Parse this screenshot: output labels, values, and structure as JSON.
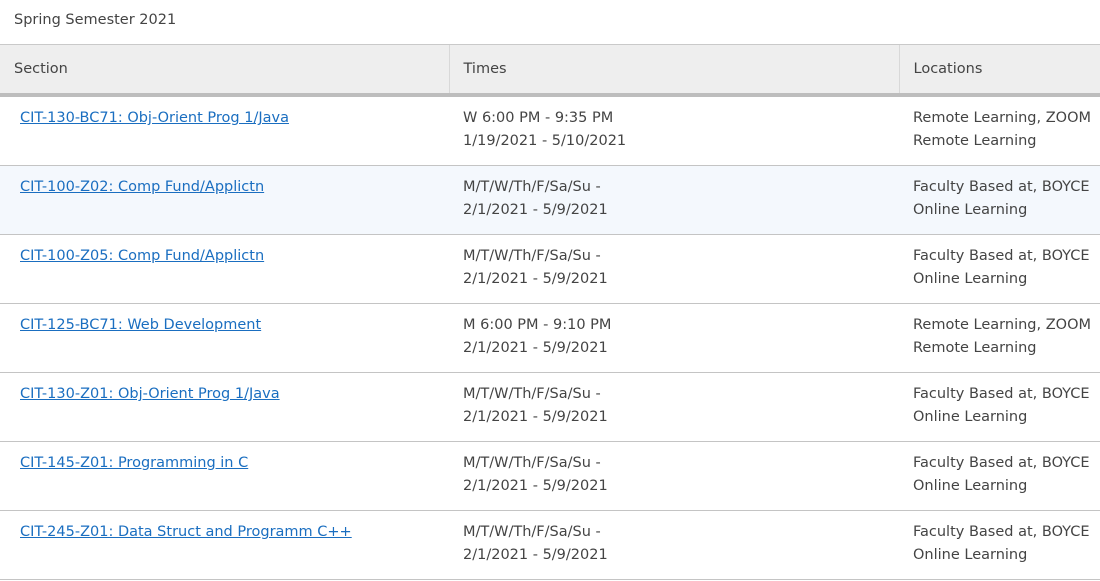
{
  "term": {
    "title": "Spring Semester 2021"
  },
  "table": {
    "headers": {
      "section": "Section",
      "times": "Times",
      "locations": "Locations"
    },
    "rows": [
      {
        "section": "CIT-130-BC71: Obj-Orient Prog 1/Java",
        "time_line1": "W 6:00 PM - 9:35 PM",
        "time_line2": "1/19/2021 - 5/10/2021",
        "location_line1": "Remote Learning, ZOOM",
        "location_line2": "Remote Learning",
        "highlighted": false
      },
      {
        "section": "CIT-100-Z02: Comp Fund/Applictn",
        "time_line1": "M/T/W/Th/F/Sa/Su -",
        "time_line2": "2/1/2021 - 5/9/2021",
        "location_line1": "Faculty Based at, BOYCE",
        "location_line2": "Online Learning",
        "highlighted": true
      },
      {
        "section": "CIT-100-Z05: Comp Fund/Applictn",
        "time_line1": "M/T/W/Th/F/Sa/Su -",
        "time_line2": "2/1/2021 - 5/9/2021",
        "location_line1": "Faculty Based at, BOYCE",
        "location_line2": "Online Learning",
        "highlighted": false
      },
      {
        "section": "CIT-125-BC71: Web Development",
        "time_line1": "M 6:00 PM - 9:10 PM",
        "time_line2": "2/1/2021 - 5/9/2021",
        "location_line1": "Remote Learning, ZOOM",
        "location_line2": "Remote Learning",
        "highlighted": false
      },
      {
        "section": "CIT-130-Z01: Obj-Orient Prog 1/Java",
        "time_line1": "M/T/W/Th/F/Sa/Su -",
        "time_line2": "2/1/2021 - 5/9/2021",
        "location_line1": "Faculty Based at, BOYCE",
        "location_line2": "Online Learning",
        "highlighted": false
      },
      {
        "section": "CIT-145-Z01: Programming in C",
        "time_line1": "M/T/W/Th/F/Sa/Su -",
        "time_line2": "2/1/2021 - 5/9/2021",
        "location_line1": "Faculty Based at, BOYCE",
        "location_line2": "Online Learning",
        "highlighted": false
      },
      {
        "section": "CIT-245-Z01: Data Struct and Programm C++",
        "time_line1": "M/T/W/Th/F/Sa/Su -",
        "time_line2": "2/1/2021 - 5/9/2021",
        "location_line1": "Faculty Based at, BOYCE",
        "location_line2": "Online Learning",
        "highlighted": false
      }
    ]
  },
  "colors": {
    "link": "#1a6ec0",
    "header_bg": "#eeeeee",
    "highlight_row_bg": "#f4f8fd",
    "text": "#444444"
  }
}
